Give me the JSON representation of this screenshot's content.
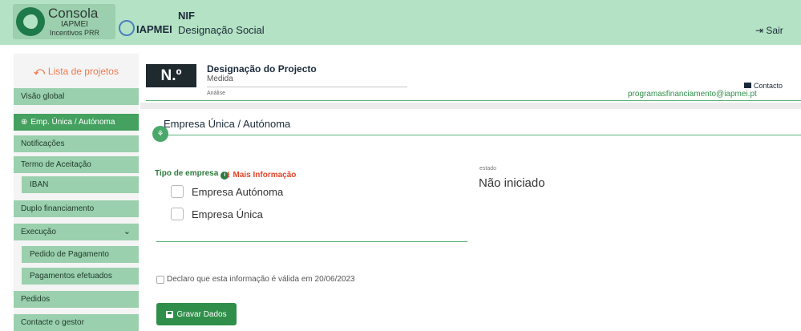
{
  "topbar": {
    "brand_title": "Consola",
    "brand_sub1": "IAPMEI",
    "brand_sub2": "Incentivos PRR",
    "iapmei_label": "IAPMEI",
    "nif_label": "NIF",
    "designacao_label": "Designação Social",
    "sair_label": "Sair"
  },
  "sidebar": {
    "head_label": "Lista de projetos",
    "items": [
      {
        "label": "Visão global"
      },
      {
        "label": "Emp. Única / Autónoma"
      },
      {
        "label": "Notificações"
      },
      {
        "label": "Termo de Aceitação"
      },
      {
        "label": "IBAN"
      },
      {
        "label": "Duplo financiamento"
      },
      {
        "label": "Execução"
      },
      {
        "label": "Pedido de Pagamento"
      },
      {
        "label": "Pagamentos efetuados"
      },
      {
        "label": "Pedidos"
      },
      {
        "label": "Contacte o gestor"
      }
    ]
  },
  "project": {
    "number_label": "N.º",
    "title": "Designação do Projecto",
    "medida": "Medida",
    "analise": "Análise",
    "contacto_label": "Contacto",
    "email": "programasfinanciamento@iapmei.pt"
  },
  "card": {
    "title": "Empresa Única / Autónoma",
    "tipo_label": "Tipo de empresa",
    "mais_info": "Mais Informação",
    "options": [
      "Empresa Autónoma",
      "Empresa Única"
    ],
    "estado_label": "estado",
    "estado_value": "Não iniciado",
    "declaro": "Declaro que esta informação é válida em 20/06/2023",
    "gravar_label": "Gravar Dados"
  },
  "colors": {
    "topbar": "#b4e2c4",
    "sidebar_item": "#9ad0ad",
    "sidebar_active": "#44a15f",
    "accent": "#2f8f4a",
    "warning": "#e0462a"
  }
}
